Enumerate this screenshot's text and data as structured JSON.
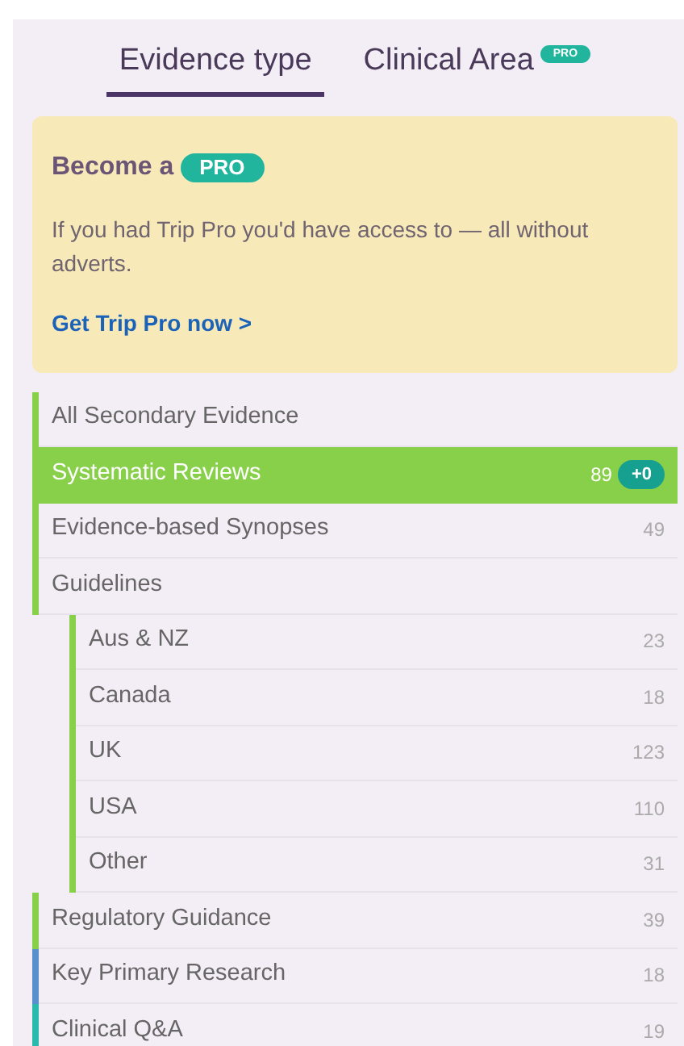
{
  "tabs": [
    {
      "label": "Evidence type",
      "selected": true
    },
    {
      "label": "Clinical Area",
      "selected": false,
      "badge": "PRO"
    }
  ],
  "promo": {
    "title": "Become a",
    "badge": "PRO",
    "text": "If you had Trip Pro you'd have access to — all without adverts.",
    "link": "Get Trip Pro now >"
  },
  "items": [
    {
      "label": "All Secondary Evidence",
      "selected": false,
      "color": "#88d04a"
    },
    {
      "label": "Systematic Reviews",
      "count": "89",
      "badge": "+0",
      "selected": true,
      "color": "#88d04a"
    },
    {
      "label": "Evidence-based Synopses",
      "count": "49",
      "selected": false,
      "color": "#88d04a"
    },
    {
      "label": "Guidelines",
      "selected": false,
      "color": "#88d04a",
      "children": [
        {
          "label": "Aus & NZ",
          "count": "23",
          "selected": false,
          "color": "#88d04a"
        },
        {
          "label": "Canada",
          "count": "18",
          "selected": false,
          "color": "#88d04a"
        },
        {
          "label": "UK",
          "count": "123",
          "selected": false,
          "color": "#88d04a"
        },
        {
          "label": "USA",
          "count": "110",
          "selected": false,
          "color": "#88d04a"
        },
        {
          "label": "Other",
          "count": "31",
          "selected": false,
          "color": "#88d04a"
        }
      ]
    },
    {
      "label": "Regulatory Guidance",
      "count": "39",
      "selected": false,
      "color": "#88d04a"
    },
    {
      "label": "Key Primary Research",
      "count": "18",
      "selected": false,
      "color": "#5a8fce"
    },
    {
      "label": "Clinical Q&A",
      "count": "19",
      "selected": false,
      "color": "#2bb9ad"
    }
  ]
}
